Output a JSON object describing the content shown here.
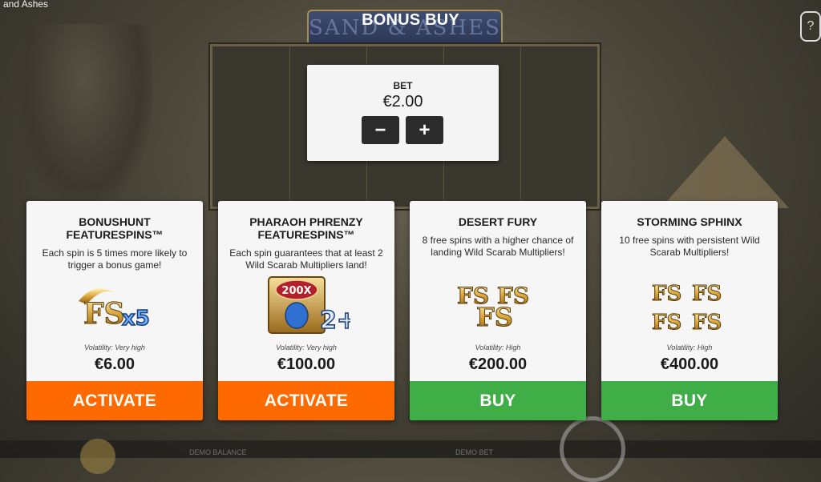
{
  "window": {
    "title": "d and Ashes"
  },
  "help_label": "?",
  "heading": "BONUS BUY",
  "background": {
    "logo_text": "SAND & ASHES",
    "balance_label": "DEMO BALANCE",
    "bet_label": "DEMO BET"
  },
  "bet": {
    "label": "BET",
    "value": "€2.00",
    "decrease_label": "−",
    "increase_label": "+"
  },
  "cards": [
    {
      "title": "BONUSHUNT FEATURESPINS™",
      "description": "Each spin is 5 times more likely to trigger a bonus game!",
      "volatility": "Volatility: Very high",
      "price": "€6.00",
      "action": "ACTIVATE",
      "action_color": "#ff6a00",
      "art_text": "FS",
      "art_extra": "x5"
    },
    {
      "title": "PHARAOH PHRENZY FEATURESPINS™",
      "description": "Each spin guarantees that at least 2 Wild Scarab Multipliers land!",
      "volatility": "Volatility: Very high",
      "price": "€100.00",
      "action": "ACTIVATE",
      "action_color": "#ff6a00",
      "art_text": "200X",
      "art_extra": "2+"
    },
    {
      "title": "DESERT FURY",
      "description": "8 free spins with a higher chance of landing Wild Scarab Multipliers!",
      "volatility": "Volatility: High",
      "price": "€200.00",
      "action": "BUY",
      "action_color": "#3fae47",
      "art_text": "FS"
    },
    {
      "title": "STORMING SPHINX",
      "description": "10 free spins with persistent Wild Scarab Multipliers!",
      "volatility": "Volatility: High",
      "price": "€400.00",
      "action": "BUY",
      "action_color": "#3fae47",
      "art_text": "FS"
    }
  ],
  "icons": {
    "card1": "fs-x5-icon",
    "card2": "scarab-multiplier-icon",
    "card3": "fs-triple-icon",
    "card4": "fs-quad-icon"
  }
}
